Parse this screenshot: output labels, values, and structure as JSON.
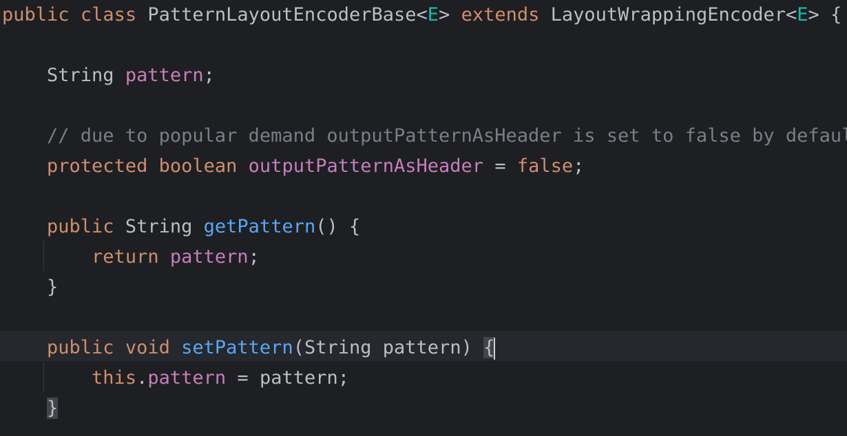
{
  "colors": {
    "background": "#1e1f22",
    "current_line": "#26282e",
    "keyword": "#cf8e6d",
    "type_param": "#16baac",
    "field": "#c77dbb",
    "method": "#56a8f5",
    "comment": "#7a7e85",
    "plain": "#bcbec4"
  },
  "code": {
    "l1": {
      "kw1": "public",
      "kw2": "class",
      "cls": "PatternLayoutEncoderBase",
      "lt1": "<",
      "tp1": "E",
      "gt1": ">",
      "kw3": "extends",
      "sup": "LayoutWrappingEncoder",
      "lt2": "<",
      "tp2": "E",
      "gt2": ">",
      "brace": "{"
    },
    "l2": {
      "type": "String",
      "field": "pattern",
      "semi": ";"
    },
    "l3": {
      "comment": "// due to popular demand outputPatternAsHeader is set to false by default"
    },
    "l4": {
      "kw1": "protected",
      "kw2": "boolean",
      "field": "outputPatternAsHeader",
      "eq": "=",
      "val": "false",
      "semi": ";"
    },
    "l5": {
      "kw": "public",
      "type": "String",
      "method": "getPattern",
      "parens": "()",
      "brace": "{"
    },
    "l6": {
      "kw": "return",
      "field": "pattern",
      "semi": ";"
    },
    "l7": {
      "brace": "}"
    },
    "l8": {
      "kw1": "public",
      "kw2": "void",
      "method": "setPattern",
      "open": "(",
      "ptype": "String",
      "pname": "pattern",
      "close": ")",
      "brace": "{"
    },
    "l9": {
      "kw": "this",
      "dot": ".",
      "field": "pattern",
      "eq": "=",
      "value": "pattern",
      "semi": ";"
    },
    "l10": {
      "brace": "}"
    }
  }
}
